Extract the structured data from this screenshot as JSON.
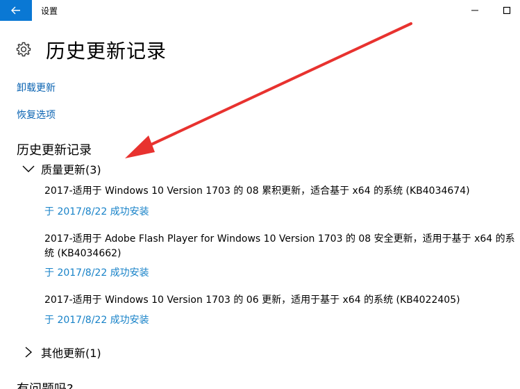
{
  "window": {
    "title": "设置",
    "back_icon": "back-arrow-icon",
    "minimize_icon": "minimize-icon",
    "maximize_icon": "maximize-icon",
    "accent_color": "#0a78d4"
  },
  "header": {
    "icon": "gear-icon",
    "title": "历史更新记录"
  },
  "links": {
    "uninstall": "卸载更新",
    "recovery": "恢复选项"
  },
  "history": {
    "section_title": "历史更新记录",
    "groups": [
      {
        "label": "质量更新(3)",
        "expanded": true,
        "items": [
          {
            "title": "2017-适用于 Windows 10 Version 1703 的 08 累积更新，适合基于 x64 的系统 (KB4034674)",
            "status": "于 2017/8/22 成功安装"
          },
          {
            "title": "2017-适用于 Adobe Flash Player for Windows 10 Version 1703 的 08 安全更新，适用于基于 x64 的系统 (KB4034662)",
            "status": "于 2017/8/22 成功安装"
          },
          {
            "title": "2017-适用于 Windows 10 Version 1703 的 06 更新，适用于基于 x64 的系统 (KB4022405)",
            "status": "于 2017/8/22 成功安装"
          }
        ]
      },
      {
        "label": "其他更新(1)",
        "expanded": false,
        "items": []
      }
    ]
  },
  "help": {
    "heading": "有问题吗?"
  },
  "annotation": {
    "color": "#e8322f"
  }
}
